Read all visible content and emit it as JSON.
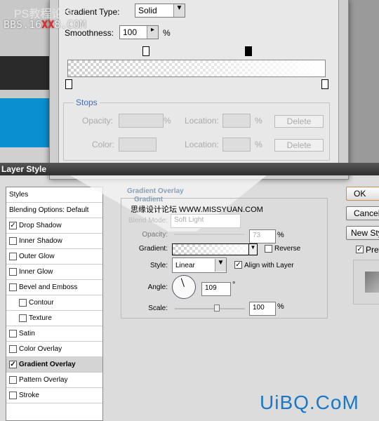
{
  "watermark": {
    "line1": "PS教程论坛",
    "line2_a": "BBS.16",
    "line2_b": "XX",
    "line2_c": "8.COM",
    "missyuan": "思缘设计论坛 WWW.MISSYUAN.COM",
    "uibq": "UiBQ.CoM"
  },
  "gradient_editor": {
    "type_label": "Gradient Type:",
    "type_value": "Solid",
    "smoothness_label": "Smoothness:",
    "smoothness_value": "100",
    "percent": "%",
    "stops_title": "Stops",
    "opacity_label": "Opacity:",
    "color_label": "Color:",
    "location_label": "Location:",
    "delete_label": "Delete"
  },
  "dialog": {
    "title": "Layer Style",
    "styles": [
      {
        "label": "Styles"
      },
      {
        "label": "Blending Options: Default"
      },
      {
        "label": "Drop Shadow",
        "checked": true
      },
      {
        "label": "Inner Shadow"
      },
      {
        "label": "Outer Glow"
      },
      {
        "label": "Inner Glow"
      },
      {
        "label": "Bevel and Emboss"
      },
      {
        "label": "Contour",
        "sub": true
      },
      {
        "label": "Texture",
        "sub": true
      },
      {
        "label": "Satin"
      },
      {
        "label": "Color Overlay"
      },
      {
        "label": "Gradient Overlay",
        "checked": true,
        "active": true
      },
      {
        "label": "Pattern Overlay"
      },
      {
        "label": "Stroke"
      }
    ],
    "panel": {
      "title": "Gradient Overlay",
      "group": "Gradient",
      "blend_label": "Blend Mode:",
      "blend_value": "Soft Light",
      "opacity_label": "Opacity:",
      "opacity_value": "73",
      "gradient_label": "Gradient:",
      "reverse_label": "Reverse",
      "reverse_checked": false,
      "style_label": "Style:",
      "style_value": "Linear",
      "align_label": "Align with Layer",
      "align_checked": true,
      "angle_label": "Angle:",
      "angle_value": "109",
      "degree": "°",
      "scale_label": "Scale:",
      "scale_value": "100",
      "percent": "%"
    },
    "buttons": {
      "ok": "OK",
      "cancel": "Cancel",
      "new_style": "New Style...",
      "preview": "Preview"
    }
  }
}
